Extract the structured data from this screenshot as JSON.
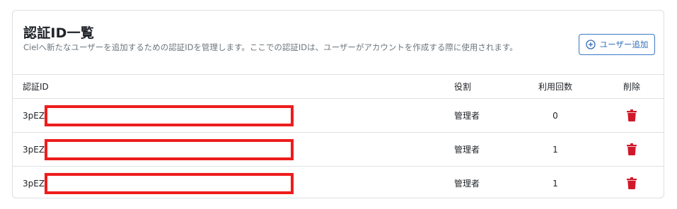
{
  "title": "認証ID一覧",
  "description": "Cielへ新たなユーザーを追加するための認証IDを管理します。ここでの認証IDは、ユーザーがアカウントを作成する際に使用されます。",
  "add_button": {
    "label": "ユーザー追加",
    "icon": "plus-circle-icon"
  },
  "table": {
    "headers": {
      "id": "認証ID",
      "role": "役割",
      "count": "利用回数",
      "delete": "削除"
    },
    "rows": [
      {
        "id": "3pEZ",
        "role": "管理者",
        "count": "0"
      },
      {
        "id": "3pEZ",
        "role": "管理者",
        "count": "1"
      },
      {
        "id": "3pEZ",
        "role": "管理者",
        "count": "1"
      }
    ]
  },
  "colors": {
    "accent": "#2f6db7",
    "danger": "#d0182a",
    "redaction": "#ee1c1c"
  }
}
